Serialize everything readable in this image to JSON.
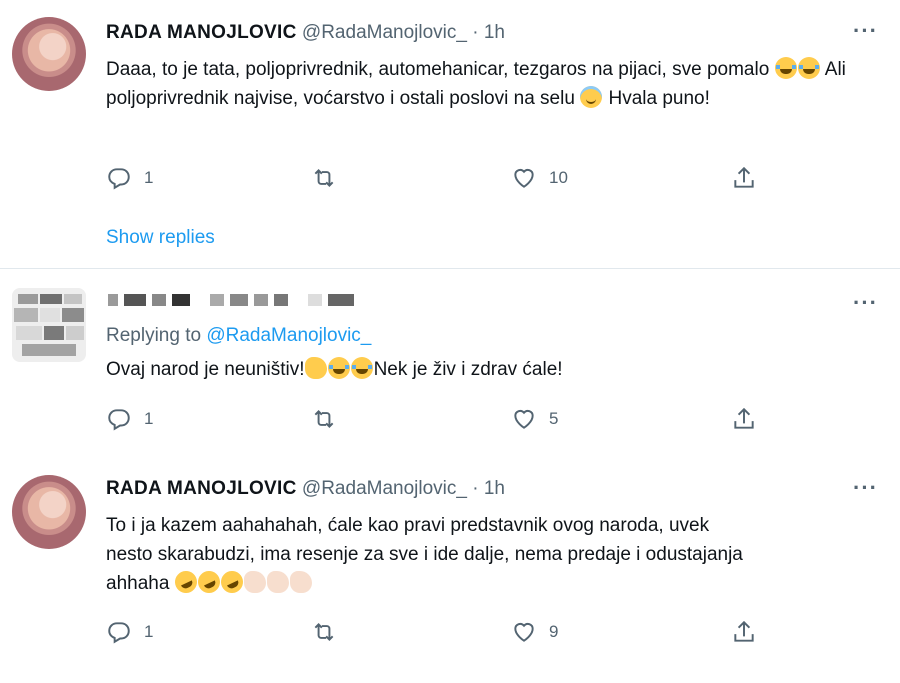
{
  "tweets": [
    {
      "name": "RADA MANOJLOVIC",
      "handle": "@RadaManojlovic_",
      "dot": "·",
      "time": "1h",
      "more": "···",
      "text_parts": [
        "Daaa, to je tata, poljoprivrednik, automehanicar, tezgaros na pijaci, sve pomalo ",
        " Ali poljoprivrednik najvise, voćarstvo i ostali poslovi na selu ",
        " Hvala puno!"
      ],
      "replies": "1",
      "retweets": "",
      "likes": "10",
      "show_replies": "Show replies"
    },
    {
      "redacted_name": true,
      "more": "···",
      "replying_prefix": "Replying to",
      "replying_mention": "@RadaManojlovic_",
      "text_parts": [
        "Ovaj narod je neuništiv!",
        "Nek je živ i zdrav ćale!"
      ],
      "replies": "1",
      "retweets": "",
      "likes": "5"
    },
    {
      "name": "RADA MANOJLOVIC",
      "handle": "@RadaManojlovic_",
      "dot": "·",
      "time": "1h",
      "more": "···",
      "text_line1": "To i ja kazem aahahahah, ćale kao pravi predstavnik ovog naroda, uvek",
      "text_line2": "nesto skarabudzi, ima resenje za sve i ide dalje, nema predaje i odustajanja",
      "text_line3": "ahhaha ",
      "replies": "1",
      "retweets": "",
      "likes": "9"
    }
  ],
  "icons": {
    "reply": "reply-icon",
    "retweet": "retweet-icon",
    "like": "heart-icon",
    "share": "share-icon",
    "more": "more-icon"
  },
  "colors": {
    "link": "#1d9bf0",
    "secondary": "#536471",
    "text": "#0f1419",
    "divider": "#e1e8ed"
  }
}
